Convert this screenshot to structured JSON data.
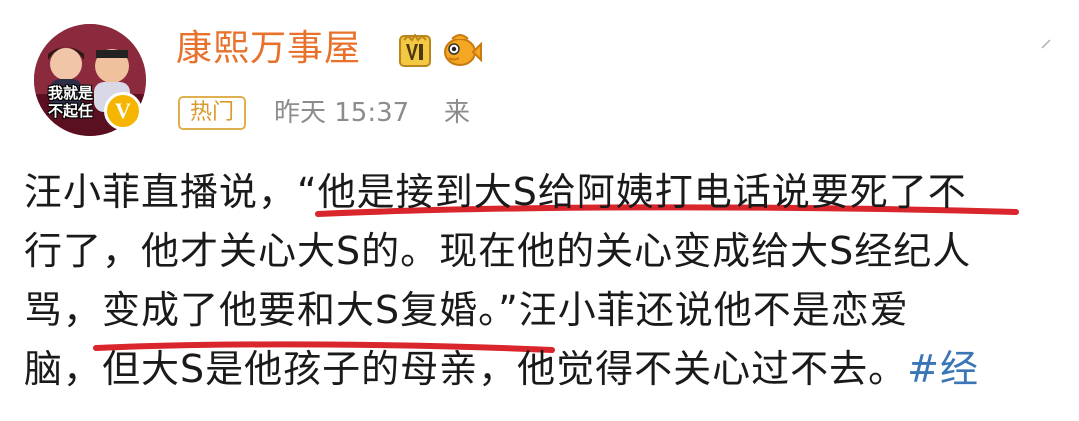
{
  "post": {
    "author": {
      "name": "康熙万事屋",
      "avatar_caption_line1": "我就是",
      "avatar_caption_line2": "不起任",
      "verified_mark": "V",
      "icons": [
        "vip-badge-icon",
        "fish-icon",
        "more-icon"
      ]
    },
    "meta": {
      "hot_tag": "热门",
      "timestamp": "昨天 15:37",
      "source": "来"
    },
    "body_lines": [
      "汪小菲直播说，“他是接到大S给阿姨打电话说要死了不",
      "行了，他才关心大S的。现在他的关心变成给大S经纪人",
      "骂，变成了他要和大S复婚。”汪小菲还说他不是恋爱",
      "脑，但大S是他孩子的母亲，他觉得不关心过不去。"
    ],
    "hashtag_fragment": "#经",
    "colors": {
      "username": "#e8712b",
      "hot_tag": "#d99a2a",
      "hashtag": "#3a76b6",
      "underline": "#d9262c",
      "body": "#1a1a1a",
      "meta": "#8c8c8c"
    }
  }
}
